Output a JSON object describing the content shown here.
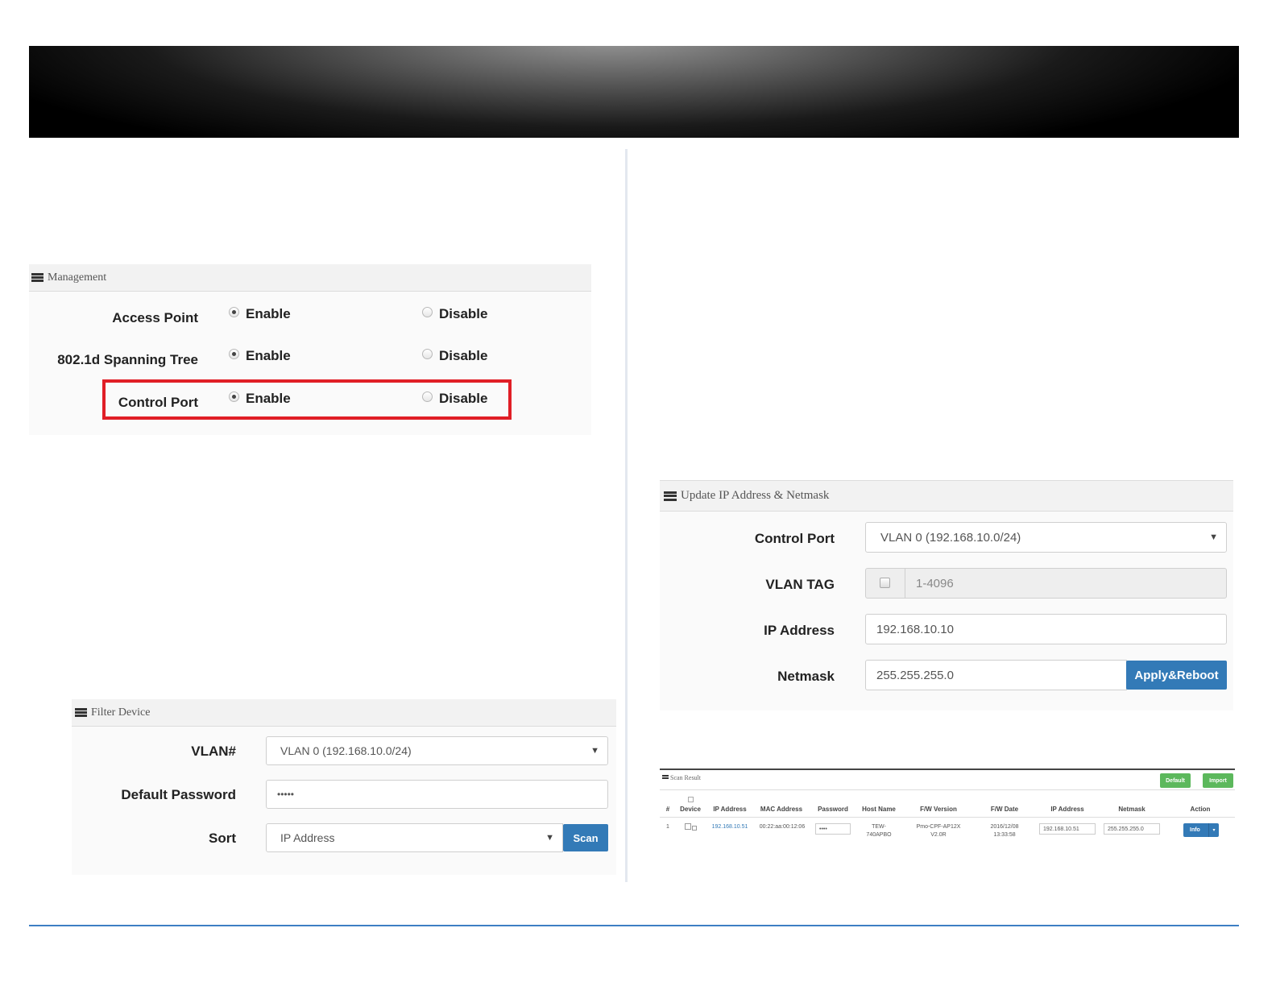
{
  "management": {
    "title": "Management",
    "rows": [
      {
        "label": "Access Point",
        "enable": "Enable",
        "disable": "Disable",
        "selected": "enable"
      },
      {
        "label": "802.1d Spanning Tree",
        "enable": "Enable",
        "disable": "Disable",
        "selected": "enable"
      },
      {
        "label": "Control Port",
        "enable": "Enable",
        "disable": "Disable",
        "selected": "enable"
      }
    ]
  },
  "filter": {
    "title": "Filter Device",
    "vlan_label": "VLAN#",
    "vlan_value": "VLAN 0 (192.168.10.0/24)",
    "password_label": "Default Password",
    "password_value": "•••••",
    "sort_label": "Sort",
    "sort_value": "IP Address",
    "scan_label": "Scan"
  },
  "update": {
    "title": "Update IP Address & Netmask",
    "control_port_label": "Control Port",
    "control_port_value": "VLAN 0 (192.168.10.0/24)",
    "vlan_tag_label": "VLAN TAG",
    "vlan_tag_placeholder": "1-4096",
    "ip_label": "IP Address",
    "ip_value": "192.168.10.10",
    "netmask_label": "Netmask",
    "netmask_value": "255.255.255.0",
    "apply_label": "Apply&Reboot"
  },
  "scan_result": {
    "title": "Scan Result",
    "default_btn": "Default",
    "import_btn": "Import",
    "headers": [
      "#",
      "Device",
      "IP Address",
      "MAC Address",
      "Password",
      "Host Name",
      "F/W Version",
      "F/W Date",
      "IP Address",
      "Netmask",
      "Action"
    ],
    "row": {
      "num": "1",
      "ip": "192.168.10.51",
      "mac": "00:22:aa:00:12:06",
      "password": "••••",
      "host_line1": "TEW-",
      "host_line2": "740APBO",
      "fw_line1": "Pmo-CPF-AP12X",
      "fw_line2": "V2.0R",
      "date_line1": "2016/12/08",
      "date_line2": "13:33:58",
      "new_ip": "192.168.10.51",
      "new_netmask": "255.255.255.0",
      "action": "Info"
    }
  },
  "colors": {
    "accent": "#337ab7",
    "highlight": "#e01e26",
    "success": "#5cb85c"
  }
}
